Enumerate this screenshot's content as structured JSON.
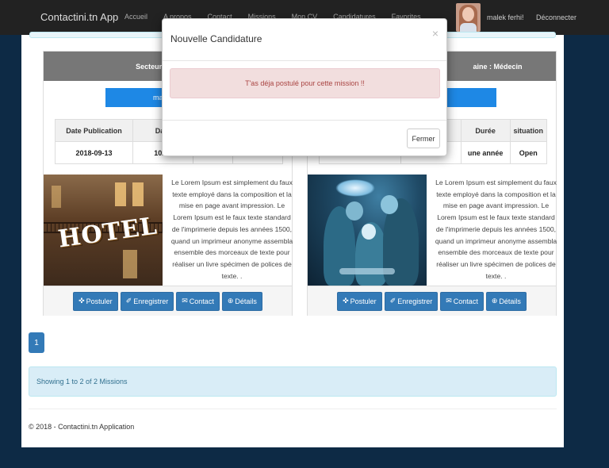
{
  "navbar": {
    "brand": "Contactini.tn App",
    "links": [
      "Accueil",
      "A propos",
      "Contact",
      "Missions",
      "Mon CV",
      "Candidatures",
      "Favorites"
    ],
    "user_name": "malek ferhi!",
    "logout": "Déconnecter"
  },
  "cards": [
    {
      "header": "Secteur : Tourisme",
      "category_button": "managem",
      "table_headers": [
        "Date Publication",
        "Date",
        "",
        ""
      ],
      "table_values": [
        "2018-09-13",
        "10/12",
        "",
        ""
      ],
      "description": "Le Lorem Ipsum est simplement du faux texte employé dans la composition et la mise en page avant impression. Le Lorem Ipsum est le faux texte standard de l'imprimerie depuis les années 1500, quand un imprimeur anonyme assembla ensemble des morceaux de texte pour réaliser un livre spécimen de polices de texte. .",
      "image": "hotel-photo"
    },
    {
      "header": "aine : Médecin",
      "category_button": "",
      "table_headers": [
        "",
        "",
        "Durée",
        "situation"
      ],
      "table_values": [
        "",
        "",
        "une année",
        "Open"
      ],
      "description": "Le Lorem Ipsum est simplement du faux texte employé dans la composition et la mise en page avant impression. Le Lorem Ipsum est le faux texte standard de l'imprimerie depuis les années 1500, quand un imprimeur anonyme assembla ensemble des morceaux de texte pour réaliser un livre spécimen de polices de texte. .",
      "image": "surgery-photo"
    }
  ],
  "card_actions": {
    "postuler": "Postuler",
    "enregistrer": "Enregistrer",
    "contact": "Contact",
    "details": "Détails",
    "icons": [
      "crosshair-icon",
      "pin-icon",
      "envelope-icon",
      "plus-circle-icon"
    ]
  },
  "pagination": {
    "current": "1"
  },
  "showing": "Showing 1 to 2 of 2 Missions",
  "footer": "© 2018 - Contactini.tn Application",
  "modal": {
    "title": "Nouvelle Candidature",
    "close_symbol": "×",
    "alert": "T'as déja postulé pour cette mission !!",
    "close_button": "Fermer"
  },
  "colors": {
    "navbar": "#222222",
    "page_background": "#0d2a45",
    "primary": "#337ab7",
    "card_header": "#777777",
    "alert_danger_bg": "#f2dede",
    "alert_danger_text": "#a94442",
    "info_bg": "#d9edf7"
  }
}
